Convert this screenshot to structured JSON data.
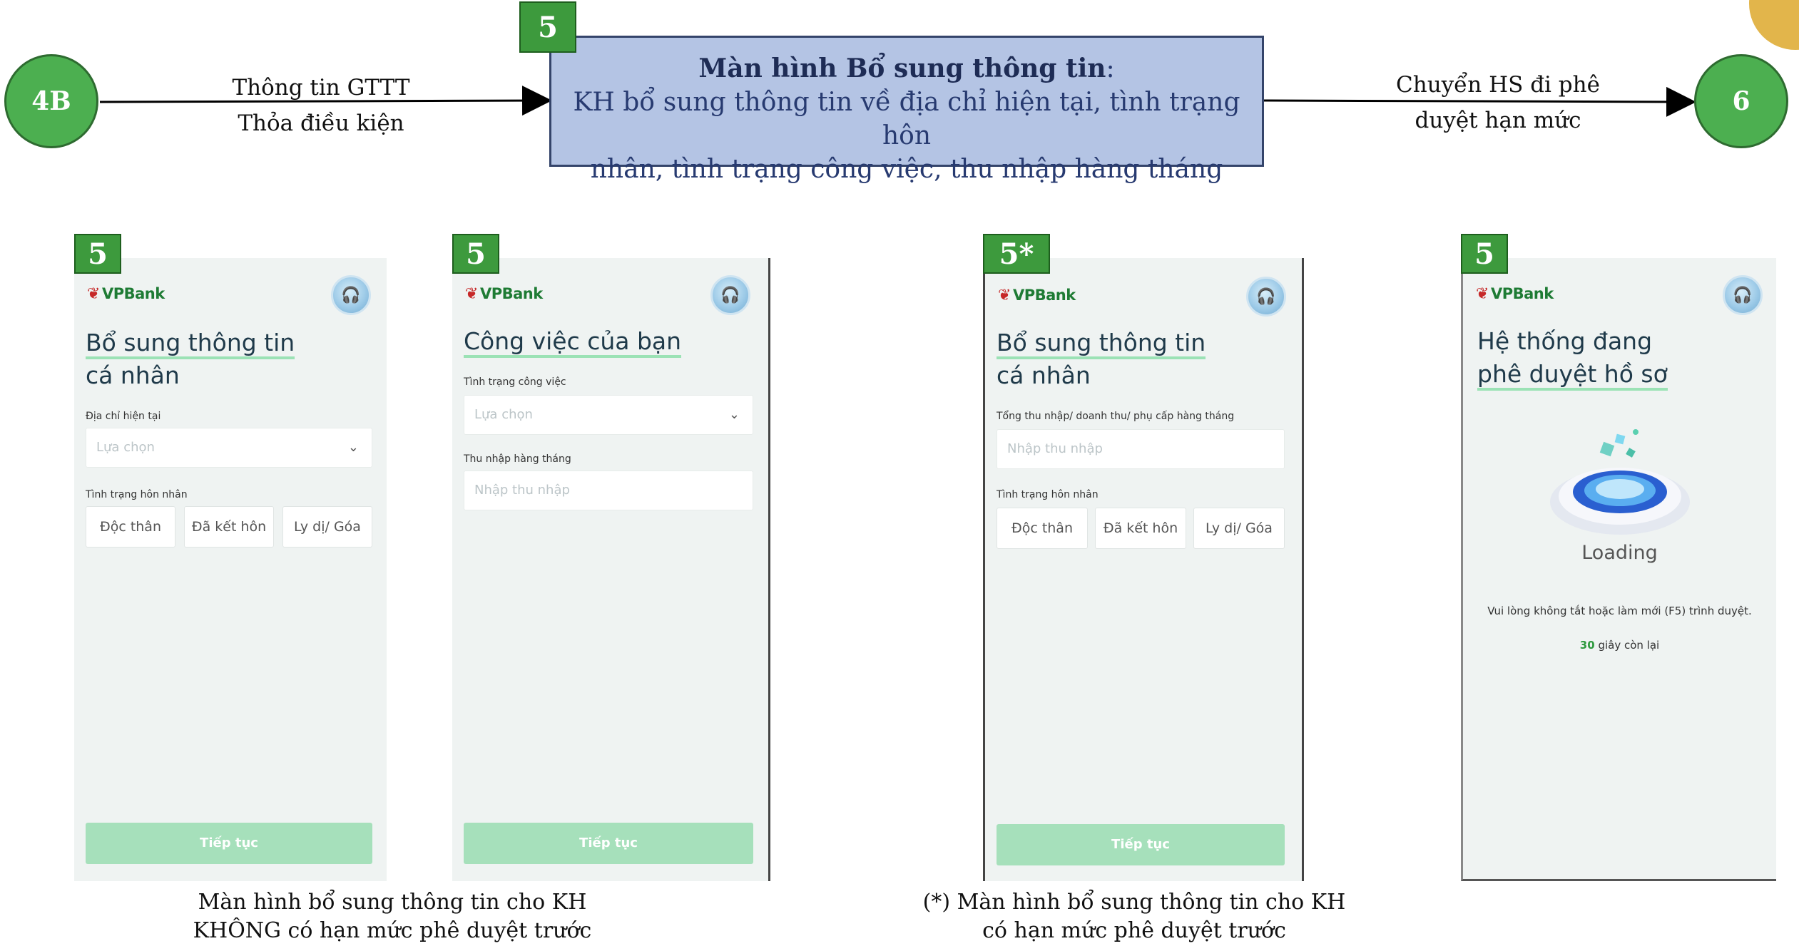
{
  "nodes": {
    "start": "4B",
    "end": "6"
  },
  "top_badge": "5",
  "arrow_left": {
    "line1": "Thông tin GTTT",
    "line2": "Thỏa điều kiện"
  },
  "arrow_right": {
    "line1": "Chuyển HS đi phê",
    "line2": "duyệt hạn mức"
  },
  "main_box": {
    "title": "Màn hình Bổ sung thông tin",
    "title_suffix": ":",
    "line1": "KH bổ sung thông tin về địa chỉ hiện tại, tình trạng hôn",
    "line2": "nhân, tình trạng công việc, thu nhập hàng tháng"
  },
  "screens": [
    {
      "badge": "5",
      "brand": "VPBank",
      "title_line1": "Bổ sung thông tin",
      "title_line2": "cá nhân",
      "field1_label": "Địa chỉ hiện tại",
      "field1_placeholder": "Lựa chọn",
      "field2_label": "Tình trạng hôn nhân",
      "options": [
        "Độc thân",
        "Đã kết hôn",
        "Ly dị/ Góa"
      ],
      "cta": "Tiếp tục"
    },
    {
      "badge": "5",
      "brand": "VPBank",
      "title_line1": "Công việc của bạn",
      "field1_label": "Tình trạng công việc",
      "field1_placeholder": "Lựa chọn",
      "field2_label": "Thu nhập hàng tháng",
      "field2_placeholder": "Nhập thu nhập",
      "cta": "Tiếp tục"
    },
    {
      "badge": "5*",
      "brand": "VPBank",
      "title_line1": "Bổ sung thông tin",
      "title_line2": "cá nhân",
      "field1_label": "Tổng thu nhập/ doanh thu/ phụ cấp hàng tháng",
      "field1_placeholder": "Nhập thu nhập",
      "field2_label": "Tình trạng hôn nhân",
      "options": [
        "Độc thân",
        "Đã kết hôn",
        "Ly dị/ Góa"
      ],
      "cta": "Tiếp tục"
    },
    {
      "badge": "5",
      "brand": "VPBank",
      "title_line1": "Hệ thống đang",
      "title_line2": "phê duyệt hồ sơ",
      "loading": "Loading",
      "message": "Vui lòng không tắt hoặc làm mới (F5) trình duyệt.",
      "countdown_value": "30",
      "countdown_suffix": "giây còn lại"
    }
  ],
  "captions": {
    "left_line1": "Màn hình bổ sung thông tin cho KH",
    "left_line2": "KHÔNG có hạn mức phê duyệt trước",
    "right_line1": "(*) Màn hình bổ sung thông tin cho KH",
    "right_line2": "có hạn mức phê duyệt trước"
  },
  "colors": {
    "node_green": "#4caf50",
    "badge_green": "#3d9a3d",
    "box_blue": "#b4c4e4",
    "cta_green": "#a6e0bb",
    "brand_red": "#e53935"
  }
}
